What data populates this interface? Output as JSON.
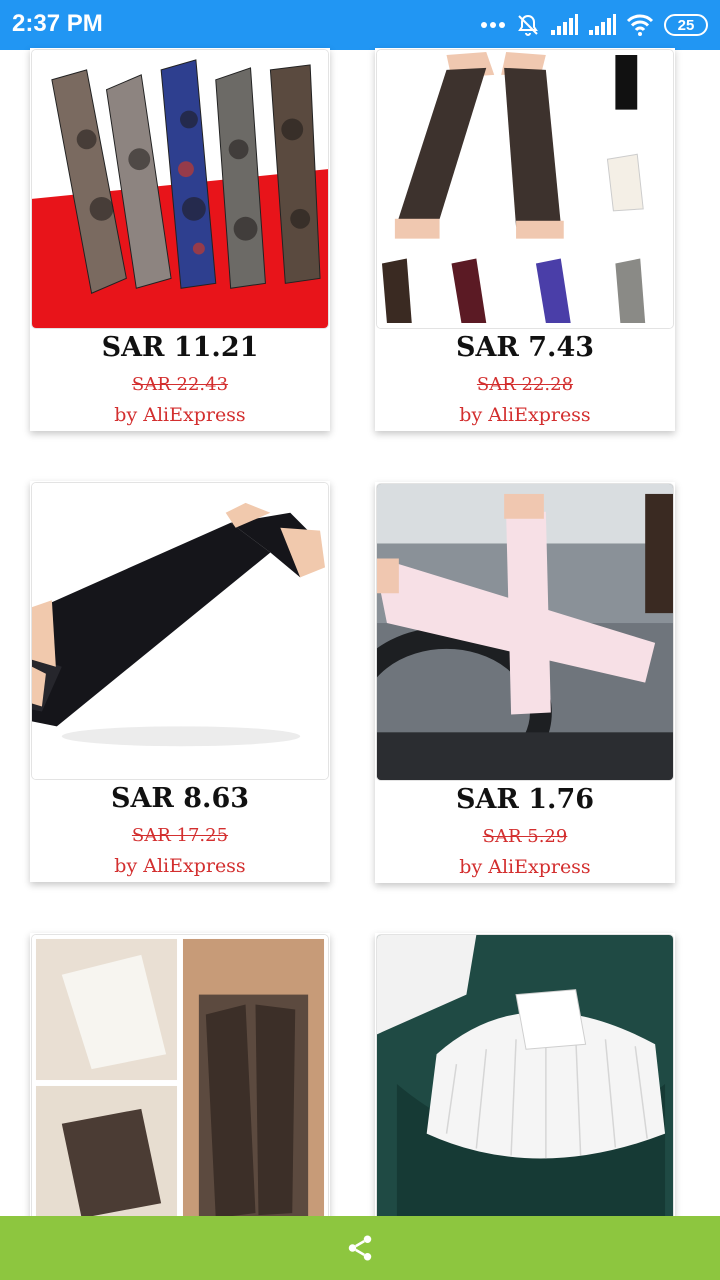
{
  "status_bar": {
    "time": "2:37 PM",
    "battery": "25",
    "color": "#2196f3",
    "icons": [
      "more-dots-icon",
      "alarm-off-icon",
      "signal-icon",
      "signal-icon",
      "wifi-icon",
      "battery-icon"
    ]
  },
  "products": [
    {
      "price": "SAR 11.21",
      "old_price": "SAR 22.43",
      "seller": "by AliExpress",
      "image": "tattoo arm sleeves"
    },
    {
      "price": "SAR 7.43",
      "old_price": "SAR 22.28",
      "seller": "by AliExpress",
      "image": "knitted fingerless arm warmers"
    },
    {
      "price": "SAR 8.63",
      "old_price": "SAR 17.25",
      "seller": "by AliExpress",
      "image": "black arm sleeve"
    },
    {
      "price": "SAR 1.76",
      "old_price": "SAR 5.29",
      "seller": "by AliExpress",
      "image": "pink arm sleeves in car"
    },
    {
      "price": "",
      "old_price": "",
      "seller": "",
      "image": "knitted fingerless gloves"
    },
    {
      "price": "",
      "old_price": "",
      "seller": "",
      "image": "white pleated detachable collar"
    }
  ],
  "bottom_bar": {
    "color": "#8dc63f",
    "share_icon": "share-icon"
  },
  "colors": {
    "price_strike": "#d32f2f",
    "seller": "#d32f2f",
    "price": "#111111"
  }
}
